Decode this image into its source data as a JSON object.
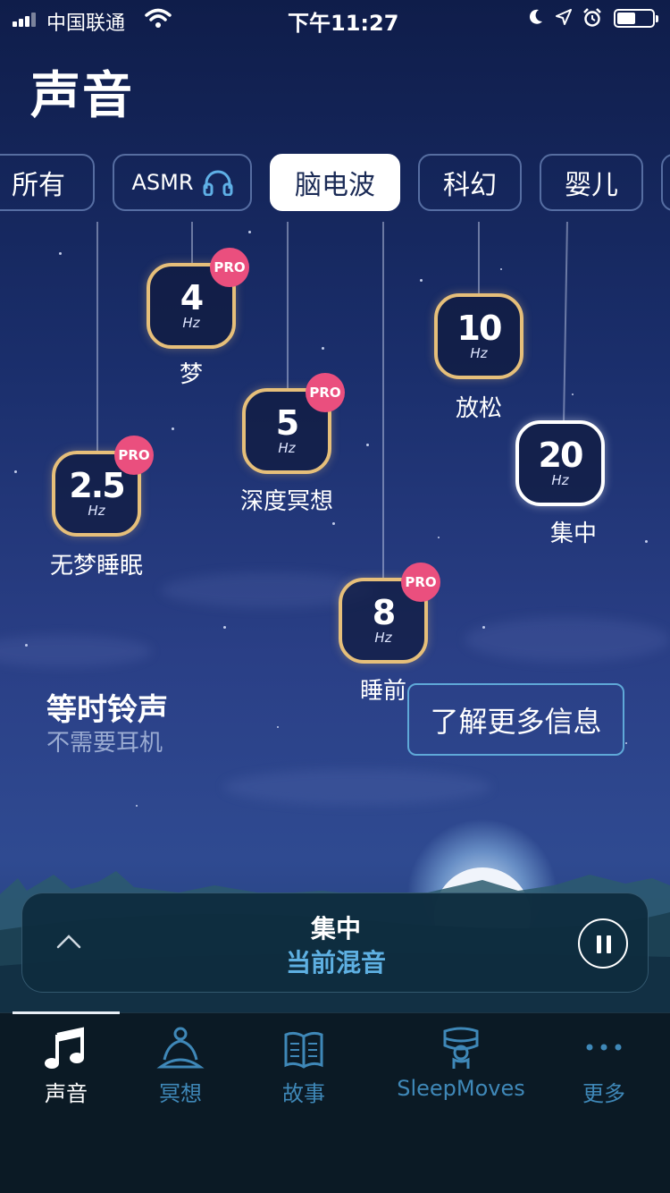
{
  "status_bar": {
    "carrier": "中国联通",
    "time": "下午11:27"
  },
  "page_title": "声音",
  "tabs": [
    {
      "label": "所有"
    },
    {
      "label": "ASMR"
    },
    {
      "label": "脑电波",
      "active": true
    },
    {
      "label": "科幻"
    },
    {
      "label": "婴儿"
    }
  ],
  "waves": [
    {
      "value": "4",
      "unit": "Hz",
      "label": "梦",
      "pro": "PRO"
    },
    {
      "value": "10",
      "unit": "Hz",
      "label": "放松"
    },
    {
      "value": "5",
      "unit": "Hz",
      "label": "深度冥想",
      "pro": "PRO"
    },
    {
      "value": "2.5",
      "unit": "Hz",
      "label": "无梦睡眠",
      "pro": "PRO"
    },
    {
      "value": "20",
      "unit": "Hz",
      "label": "集中",
      "selected": true
    },
    {
      "value": "8",
      "unit": "Hz",
      "label": "睡前",
      "pro": "PRO"
    }
  ],
  "isochronic": {
    "title": "等时铃声",
    "subtitle": "不需要耳机",
    "more_button": "了解更多信息"
  },
  "now_playing": {
    "title": "集中",
    "subtitle": "当前混音"
  },
  "tab_bar": [
    {
      "label": "声音",
      "icon": "music-note-icon",
      "active": true
    },
    {
      "label": "冥想",
      "icon": "meditation-icon"
    },
    {
      "label": "故事",
      "icon": "book-icon"
    },
    {
      "label": "SleepMoves",
      "icon": "sleepmoves-icon"
    },
    {
      "label": "更多",
      "icon": "more-dots-icon"
    }
  ],
  "colors": {
    "accent": "#5eb0e2",
    "pro_badge": "#ea4f7e",
    "node_border": "#e6bf7a"
  }
}
